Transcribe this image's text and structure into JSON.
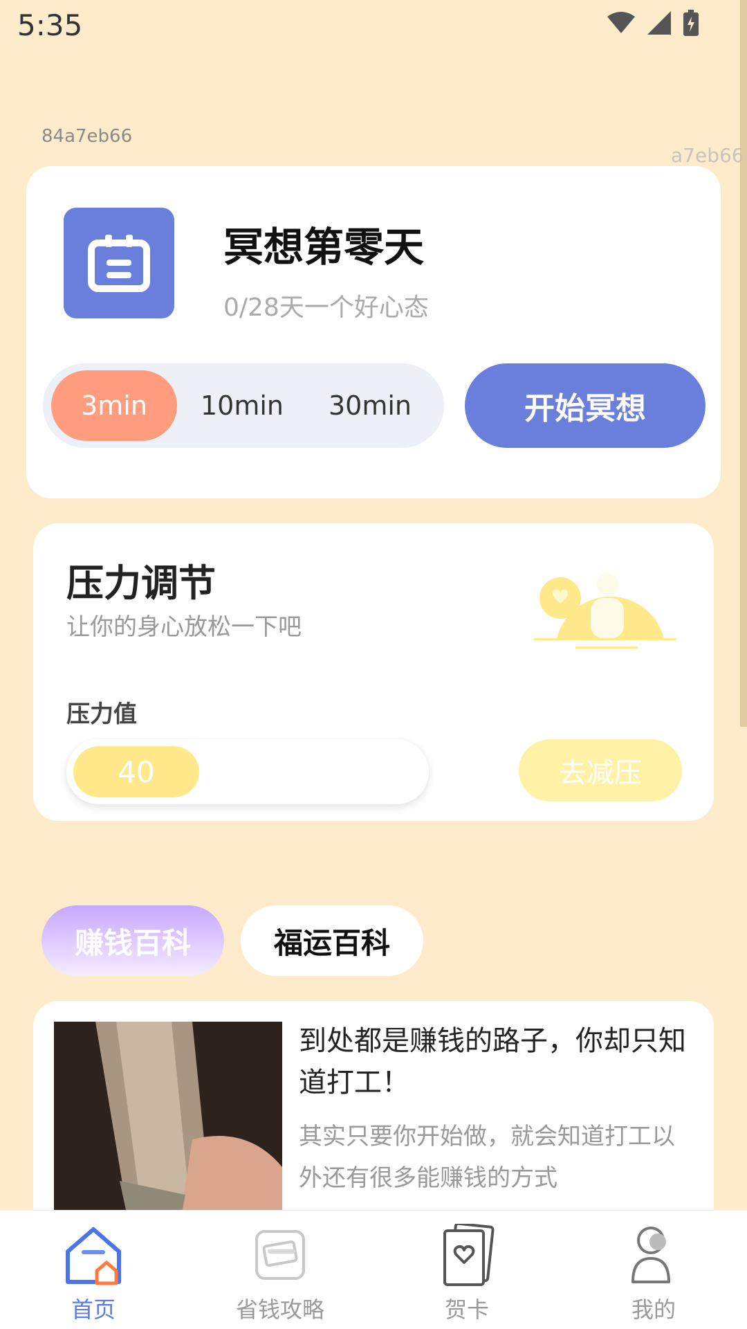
{
  "status": {
    "time": "5:35"
  },
  "tags": {
    "left": "84a7eb66",
    "right": "a7eb66"
  },
  "meditation": {
    "title": "冥想第零天",
    "subtitle": "0/28天一个好心态",
    "durations": [
      "3min",
      "10min",
      "30min"
    ],
    "selected_duration": "3min",
    "start_label": "开始冥想",
    "accent": "#6a7edb",
    "selected_color": "#ff9d7e"
  },
  "stress": {
    "title": "压力调节",
    "subtitle": "让你的身心放松一下吧",
    "value_label": "压力值",
    "value": "40",
    "action_label": "去减压"
  },
  "tabs": [
    {
      "label": "赚钱百科",
      "active": true
    },
    {
      "label": "福运百科",
      "active": false
    }
  ],
  "article": {
    "title": "到处都是赚钱的路子，你却只知道打工！",
    "desc": "其实只要你开始做，就会知道打工以外还有很多能赚钱的方式"
  },
  "nav": [
    {
      "label": "首页",
      "icon": "home-icon",
      "active": true
    },
    {
      "label": "省钱攻略",
      "icon": "money-guide-icon",
      "active": false
    },
    {
      "label": "贺卡",
      "icon": "greeting-card-icon",
      "active": false
    },
    {
      "label": "我的",
      "icon": "profile-icon",
      "active": false
    }
  ]
}
